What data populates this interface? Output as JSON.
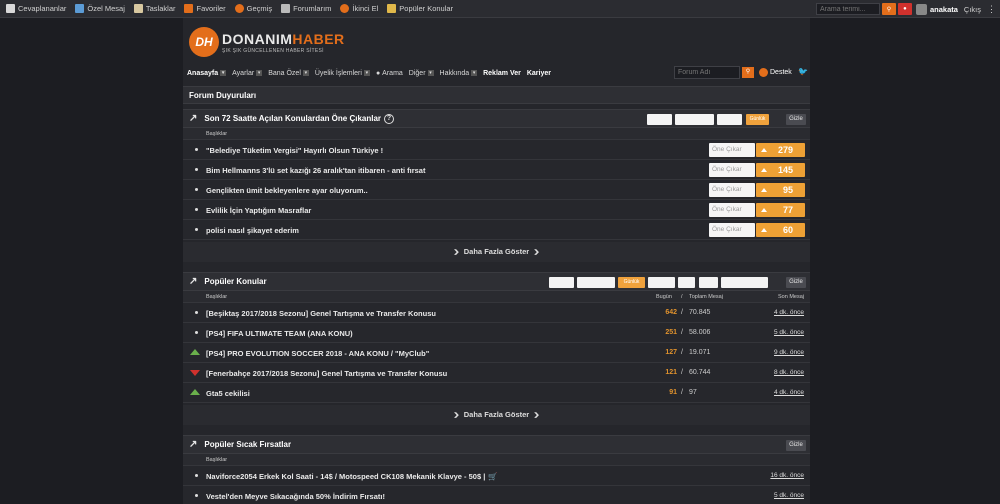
{
  "topbar": {
    "items": [
      {
        "label": "Cevaplananlar",
        "color": "#d9d9d9"
      },
      {
        "label": "Özel Mesaj",
        "color": "#5b9bd5"
      },
      {
        "label": "Taslaklar",
        "color": "#d8c8a0"
      },
      {
        "label": "Favoriler",
        "color": "#e36e1b"
      },
      {
        "label": "Geçmiş",
        "color": "#e36e1b"
      },
      {
        "label": "Forumlarım",
        "color": "#bbbbbb"
      },
      {
        "label": "İkinci El",
        "color": "#e36e1b"
      },
      {
        "label": "Popüler Konular",
        "color": "#e0b84a"
      }
    ],
    "search_placeholder": "Arama terimi...",
    "username": "anakata",
    "logout": "Çıkış"
  },
  "logo": {
    "mark": "DH",
    "name_a": "DONANIM",
    "name_b": "HABER",
    "tagline": "ŞIK ŞIK GÜNCELLENEN HABER SİTESİ"
  },
  "nav": {
    "items": [
      {
        "label": "Anasayfa",
        "bold": true,
        "arrow": true
      },
      {
        "label": "Ayarlar",
        "bold": false,
        "arrow": true
      },
      {
        "label": "Bana Özel",
        "bold": false,
        "arrow": true
      },
      {
        "label": "Üyelik İşlemleri",
        "bold": false,
        "arrow": true
      },
      {
        "label": "Arama",
        "bold": false,
        "arrow": false
      },
      {
        "label": "Diğer",
        "bold": false,
        "arrow": true
      },
      {
        "label": "Hakkında",
        "bold": false,
        "arrow": true
      },
      {
        "label": "Reklam Ver",
        "bold": true,
        "arrow": false
      },
      {
        "label": "Kariyer",
        "bold": true,
        "arrow": false
      }
    ],
    "search_placeholder": "Forum Adı",
    "destek": "Destek"
  },
  "announcements": {
    "title": "Forum Duyuruları"
  },
  "trending": {
    "title": "Son 72 Saatte Açılan Konulardan Öne Çıkanlar",
    "active_filter": "Günlük",
    "hide": "Gizle",
    "col_topics": "Başlıklar",
    "feature_label": "Öne Çıkar",
    "rows": [
      {
        "title": "\"Belediye Tüketim Vergisi\" Hayırlı Olsun Türkiye !",
        "votes": "279"
      },
      {
        "title": "Bim Hellmanns 3'lü set kazığı 26 aralık'tan itibaren - anti fırsat",
        "votes": "145"
      },
      {
        "title": "Gençlikten ümit bekleyenlere ayar oluyorum..",
        "votes": "95"
      },
      {
        "title": "Evlilik İçin Yaptığım Masraflar",
        "votes": "77"
      },
      {
        "title": "polisi nasıl şikayet ederim",
        "votes": "60"
      }
    ],
    "more": "Daha Fazla Göster"
  },
  "popular": {
    "title": "Popüler Konular",
    "active_filter": "Günlük",
    "hide": "Gizle",
    "col_topics": "Başlıklar",
    "col_today": "Bugün",
    "col_sep": "/",
    "col_total": "Toplam Mesaj",
    "col_last": "Son Mesaj",
    "rows": [
      {
        "title": "[Beşiktaş 2017/2018 Sezonu] Genel Tartışma ve Transfer Konusu",
        "today": "642",
        "total": "70.845",
        "last": "4 dk. önce",
        "trend": "none"
      },
      {
        "title": "[PS4] FIFA ULTIMATE TEAM (ANA KONU)",
        "today": "251",
        "total": "58.006",
        "last": "5 dk. önce",
        "trend": "none"
      },
      {
        "title": "[PS4] PRO EVOLUTION SOCCER 2018 - ANA KONU / \"MyClub\"",
        "today": "127",
        "total": "19.071",
        "last": "9 dk. önce",
        "trend": "up"
      },
      {
        "title": "[Fenerbahçe 2017/2018 Sezonu] Genel Tartışma ve Transfer Konusu",
        "today": "121",
        "total": "60.744",
        "last": "8 dk. önce",
        "trend": "down"
      },
      {
        "title": "Gta5 cekilisi",
        "today": "91",
        "total": "97",
        "last": "4 dk. önce",
        "trend": "up"
      }
    ],
    "more": "Daha Fazla Göster"
  },
  "deals": {
    "title": "Popüler Sıcak Fırsatlar",
    "hide": "Gizle",
    "col_topics": "Başlıklar",
    "rows": [
      {
        "title": "Naviforce2054 Erkek Kol Saati - 14$ / Motospeed CK108 Mekanik Klavye - 50$ |",
        "cart": "🛒",
        "last": "16 dk. önce"
      },
      {
        "title": "Vestel'den Meyve Sıkacağında 50% İndirim Fırsatı!",
        "cart": "",
        "last": "5 dk. önce"
      }
    ]
  }
}
